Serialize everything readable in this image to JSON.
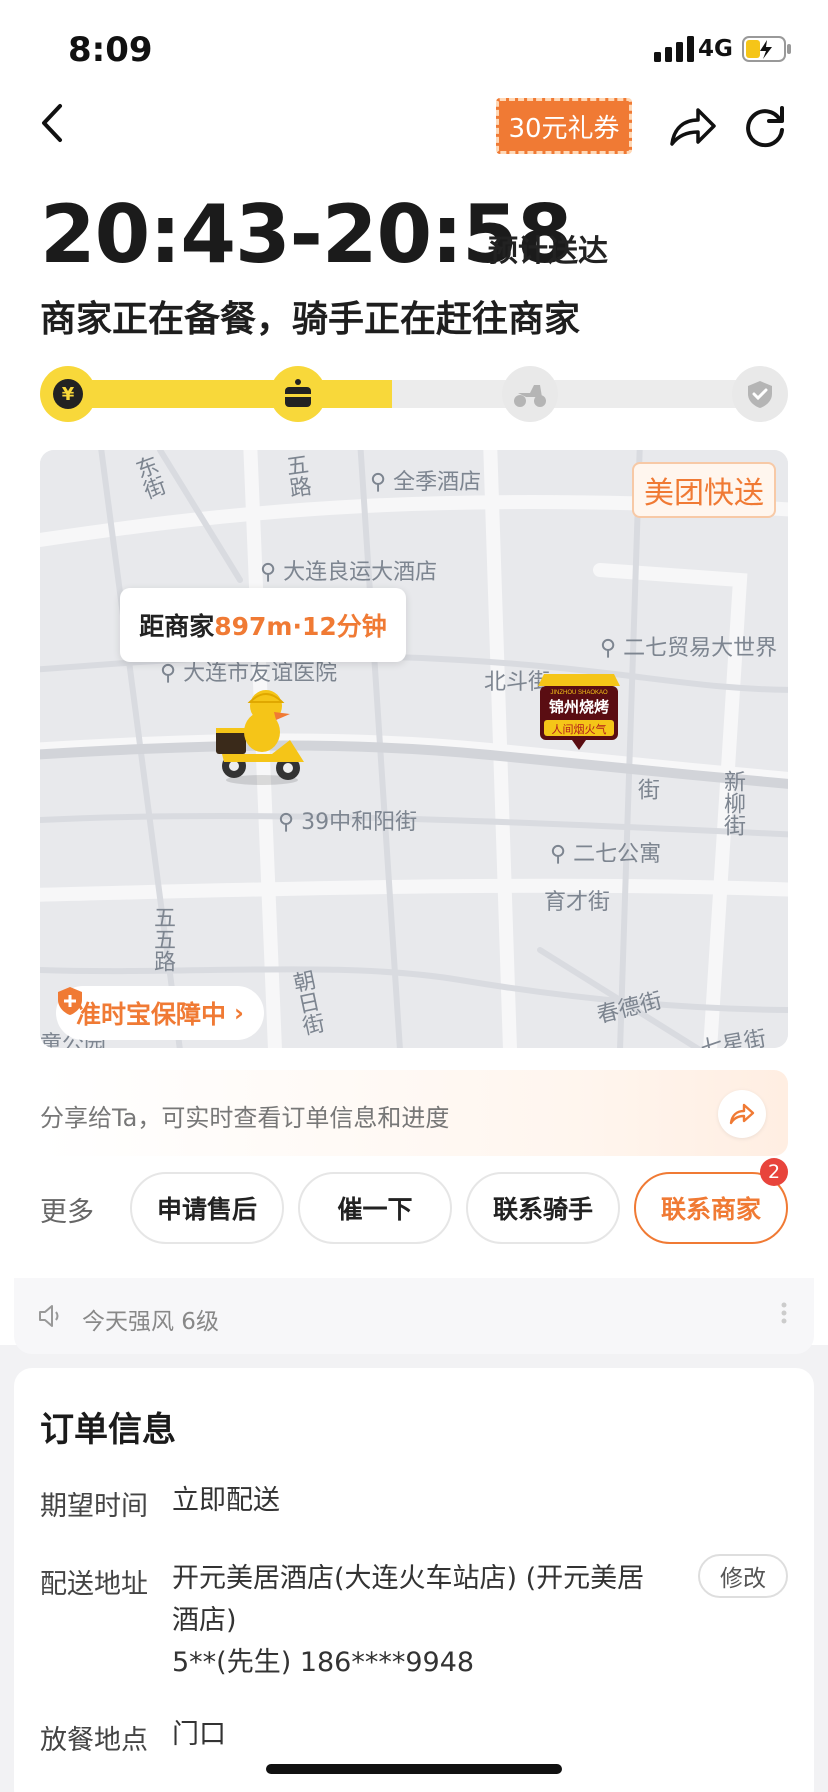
{
  "status_bar": {
    "time": "8:09",
    "network": "4G"
  },
  "header": {
    "coupon_label": "30元礼券"
  },
  "delivery": {
    "eta_range": "20:43-20:58",
    "eta_suffix": "预计送达",
    "status_text": "商家正在备餐，骑手正在赶往商家",
    "progress_fraction": 0.47,
    "steps": [
      "yen-icon",
      "cake-box-icon",
      "scooter-icon",
      "check-icon"
    ]
  },
  "map": {
    "brand_tag": "美团快送",
    "distance_prefix": "距商家",
    "distance_value": "897m·12分钟",
    "guarantee_label": "准时宝保障中",
    "places": {
      "p1": "全季酒店",
      "p2": "大连良运大酒店",
      "p3": "二七贸易大世界",
      "p4": "大连市友谊医院",
      "p5": "39中和阳街",
      "p6": "二七公寓",
      "p7": "北斗街",
      "p8": "育才街",
      "p9": "春德街",
      "p10": "新柳街",
      "p11": "东街",
      "p12": "五路",
      "p13": "五五路",
      "p14": "朝日街",
      "p15": "街",
      "p16": "童公园",
      "p17": "七星街"
    },
    "store_sign": {
      "main": "锦州烧烤",
      "sub": "人间烟火气",
      "top": "JINZHOU SHAOKAO"
    }
  },
  "share": {
    "text": "分享给Ta，可实时查看订单信息和进度"
  },
  "actions": {
    "more_label": "更多",
    "buttons": [
      "申请售后",
      "催一下",
      "联系骑手",
      "联系商家"
    ],
    "merchant_badge": "2"
  },
  "notice": {
    "text": "今天强风 6级"
  },
  "order_info": {
    "title": "订单信息",
    "rows": [
      {
        "label": "期望时间",
        "value": "立即配送"
      },
      {
        "label": "配送地址",
        "value_line1": "开元美居酒店(大连火车站店) (开元美居",
        "value_line2": "酒店)",
        "value_line3": "5**(先生) 186****9948",
        "edit_label": "修改"
      },
      {
        "label": "放餐地点",
        "value": "门口"
      }
    ]
  },
  "colors": {
    "accent": "#f07a34",
    "progress": "#f8d83a"
  }
}
